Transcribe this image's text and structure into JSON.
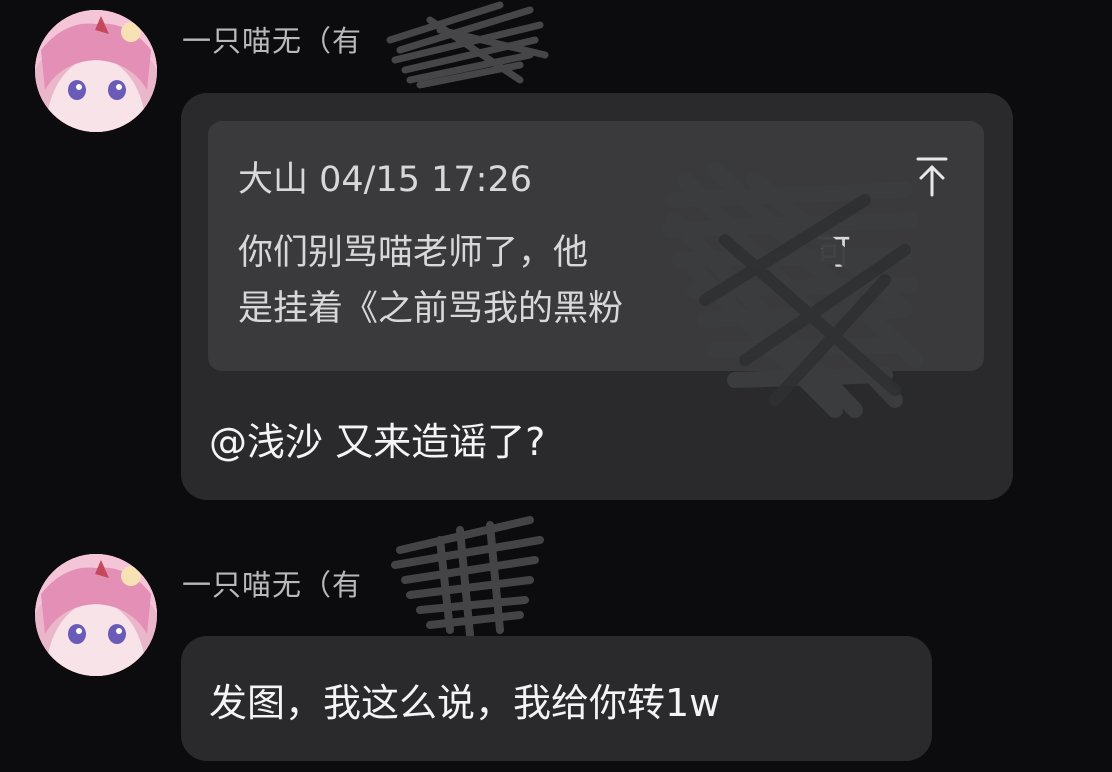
{
  "messages": [
    {
      "sender": "一只喵无（有",
      "quote": {
        "author_time": "大山 04/15 17:26",
        "lines": [
          "你们别骂喵老师了，他",
          "可",
          "是挂着《之前骂我的黑粉"
        ]
      },
      "text": "@浅沙 又来造谣了?"
    },
    {
      "sender": "一只喵无（有",
      "text": "发图，我这么说，我给你转1w"
    }
  ],
  "icons": {
    "avatar": "anime-avatar-icon",
    "quote_jump": "arrow-up-to-top-icon"
  },
  "colors": {
    "background": "#0c0b0d",
    "bubble": "#2a2a2d",
    "quote": "#3a3a3d"
  }
}
